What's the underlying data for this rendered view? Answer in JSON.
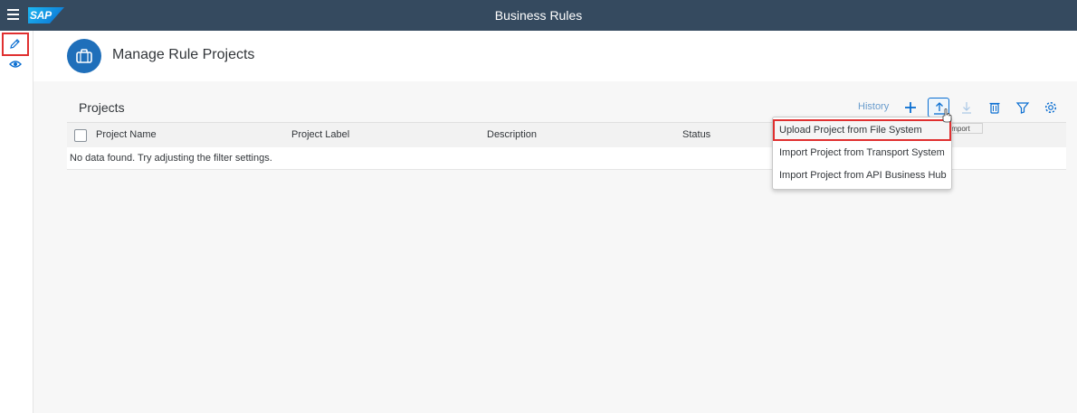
{
  "shell": {
    "title": "Business Rules",
    "logo": "SAP"
  },
  "sidebar": {
    "items": [
      {
        "icon": "pencil-icon",
        "active": true
      },
      {
        "icon": "eye-icon",
        "active": false
      }
    ]
  },
  "header": {
    "title": "Manage Rule Projects",
    "icon": "briefcase-icon"
  },
  "projects": {
    "title": "Projects",
    "toolbar": {
      "history_label": "History",
      "buttons": [
        "add-icon",
        "upload-icon",
        "download-icon",
        "delete-icon",
        "filter-icon",
        "settings-icon"
      ]
    },
    "columns": [
      "Project Name",
      "Project Label",
      "Description",
      "Status"
    ],
    "empty_text": "No data found. Try adjusting the filter settings."
  },
  "tooltip": {
    "text": "Import"
  },
  "import_menu": {
    "items": [
      "Upload Project from File System",
      "Import Project from Transport System",
      "Import Project from API Business Hub"
    ]
  },
  "colors": {
    "shellbar": "#354a5f",
    "accent": "#0a6ed1",
    "highlight": "#e03030"
  }
}
